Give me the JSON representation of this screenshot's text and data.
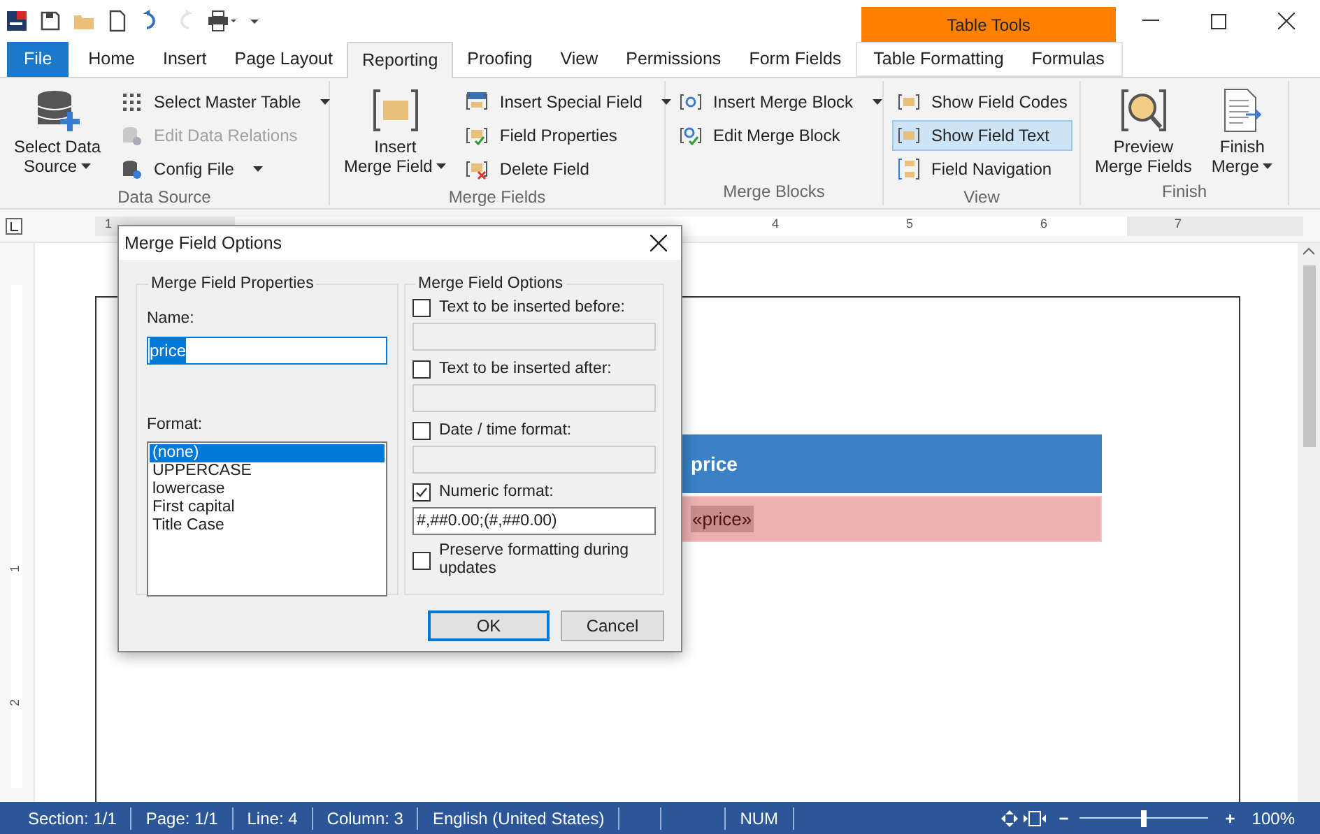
{
  "quick_access": [
    {
      "kind": "logo",
      "disabled": false
    },
    {
      "kind": "save",
      "disabled": false
    },
    {
      "kind": "open",
      "disabled": false
    },
    {
      "kind": "new",
      "disabled": false
    },
    {
      "kind": "undo",
      "disabled": false
    },
    {
      "kind": "redo",
      "disabled": true
    },
    {
      "kind": "print",
      "disabled": false
    },
    {
      "kind": "customize",
      "disabled": false
    }
  ],
  "contextual_header": {
    "title": "Table Tools"
  },
  "tabs": [
    {
      "label": "File",
      "kind": "file",
      "selected": false
    },
    {
      "label": "Home",
      "kind": "tab",
      "selected": false
    },
    {
      "label": "Insert",
      "kind": "tab",
      "selected": false
    },
    {
      "label": "Page Layout",
      "kind": "tab",
      "selected": false
    },
    {
      "label": "Reporting",
      "kind": "tab",
      "selected": true
    },
    {
      "label": "Proofing",
      "kind": "tab",
      "selected": false
    },
    {
      "label": "View",
      "kind": "tab",
      "selected": false
    },
    {
      "label": "Permissions",
      "kind": "tab",
      "selected": false
    },
    {
      "label": "Form Fields",
      "kind": "tab",
      "selected": false
    },
    {
      "label": "Table Formatting",
      "kind": "contextual",
      "selected": false
    },
    {
      "label": "Formulas",
      "kind": "contextual",
      "selected": false
    }
  ],
  "ribbon": [
    {
      "title": "Data Source",
      "items": [
        {
          "kind": "large",
          "lines": [
            "Select Data",
            "Source"
          ],
          "dropdown": true
        },
        {
          "kind": "small",
          "label": "Select Master Table",
          "dropdown": true,
          "disabled": false,
          "active": false
        },
        {
          "kind": "small",
          "label": "Edit Data Relations",
          "dropdown": false,
          "disabled": true,
          "active": false
        },
        {
          "kind": "small",
          "label": "Config File",
          "dropdown": true,
          "disabled": false,
          "active": false
        }
      ]
    },
    {
      "title": "Merge Fields",
      "items": [
        {
          "kind": "large",
          "lines": [
            "Insert",
            "Merge Field"
          ],
          "dropdown": true
        },
        {
          "kind": "small",
          "label": "Insert Special Field",
          "dropdown": true,
          "disabled": false,
          "active": false
        },
        {
          "kind": "small",
          "label": "Field Properties",
          "dropdown": false,
          "disabled": false,
          "active": false
        },
        {
          "kind": "small",
          "label": "Delete Field",
          "dropdown": false,
          "disabled": false,
          "active": false
        }
      ]
    },
    {
      "title": "Merge Blocks",
      "items": [
        {
          "kind": "small",
          "label": "Insert Merge Block",
          "dropdown": true,
          "disabled": false,
          "active": false
        },
        {
          "kind": "small",
          "label": "Edit Merge Block",
          "dropdown": false,
          "disabled": false,
          "active": false
        }
      ]
    },
    {
      "title": "View",
      "items": [
        {
          "kind": "small",
          "label": "Show Field Codes",
          "dropdown": false,
          "disabled": false,
          "active": false
        },
        {
          "kind": "small",
          "label": "Show Field Text",
          "dropdown": false,
          "disabled": false,
          "active": true
        },
        {
          "kind": "small",
          "label": "Field Navigation",
          "dropdown": false,
          "disabled": false,
          "active": false
        }
      ]
    },
    {
      "title": "Finish",
      "items": [
        {
          "kind": "large",
          "lines": [
            "Preview",
            "Merge Fields"
          ],
          "dropdown": false
        },
        {
          "kind": "large",
          "lines": [
            "Finish",
            "Merge"
          ],
          "dropdown": true
        }
      ]
    }
  ],
  "ruler": {
    "horizontal": [
      "1",
      "4",
      "5",
      "6",
      "7"
    ],
    "vertical": [
      "1",
      "2"
    ]
  },
  "document": {
    "table": {
      "header": "price",
      "cell": "«price»"
    }
  },
  "dialog": {
    "title": "Merge Field Options",
    "properties": {
      "title": "Merge Field Properties",
      "name_label": "Name:",
      "name_value": "price",
      "name_text_selected": true,
      "format_label": "Format:",
      "formats": [
        {
          "label": "(none)",
          "selected": true
        },
        {
          "label": "UPPERCASE",
          "selected": false
        },
        {
          "label": "lowercase",
          "selected": false
        },
        {
          "label": "First capital",
          "selected": false
        },
        {
          "label": "Title Case",
          "selected": false
        }
      ]
    },
    "options": {
      "title": "Merge Field Options",
      "items": [
        {
          "kind": "checkbox_field",
          "label": "Text to be inserted before:",
          "checked": false,
          "field_disabled": true
        },
        {
          "kind": "checkbox_field",
          "label": "Text to be inserted after:",
          "checked": false,
          "field_disabled": true
        },
        {
          "kind": "checkbox_field",
          "label": "Date / time format:",
          "checked": false,
          "field_disabled": true
        },
        {
          "kind": "checkbox_field",
          "label": "Numeric format:",
          "checked": true,
          "field_disabled": false,
          "value": "#,##0.00;(#,##0.00)"
        },
        {
          "kind": "checkbox",
          "label": "Preserve formatting during updates",
          "checked": false
        }
      ]
    },
    "buttons": [
      {
        "label": "OK",
        "default": true
      },
      {
        "label": "Cancel",
        "default": false
      }
    ]
  },
  "status_bar": {
    "items": [
      "Section: 1/1",
      "Page: 1/1",
      "Line: 4",
      "Column: 3",
      "English (United States)"
    ],
    "indicator": "NUM",
    "zoom": {
      "out": "−",
      "in": "+",
      "level": 0.5,
      "reading": "100%"
    }
  }
}
